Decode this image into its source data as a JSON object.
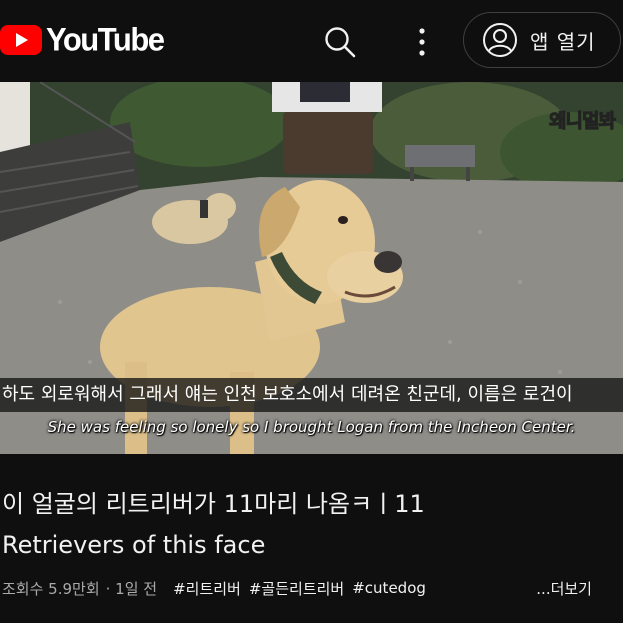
{
  "header": {
    "logo_text": "YouTube",
    "open_app_label": "앱 열기"
  },
  "video": {
    "watermark": "왜니멀봐",
    "subtitle_korean": "하도 외로워해서 그래서 얘는 인천 보호소에서 데려온 친군데, 이름은 로건이",
    "subtitle_english": "She was feeling so lonely so I brought Logan from the  Incheon Center."
  },
  "info": {
    "title_line1": "이 얼굴의 리트리버가 11마리 나옴ㅋㅣ11",
    "title_line2": "Retrievers of this face",
    "views": "조회수 5.9만회",
    "age": "· 1일 전",
    "tags": [
      "#리트리버",
      "#골든리트리버",
      "#cutedog"
    ],
    "more_label": "...더보기"
  },
  "colors": {
    "background": "#0f0f0f",
    "brand_red": "#ff0000",
    "text_primary": "#f1f1f1",
    "text_secondary": "#aaaaaa"
  },
  "icons": [
    "youtube-logo-icon",
    "search-icon",
    "more-vertical-icon",
    "account-icon"
  ]
}
